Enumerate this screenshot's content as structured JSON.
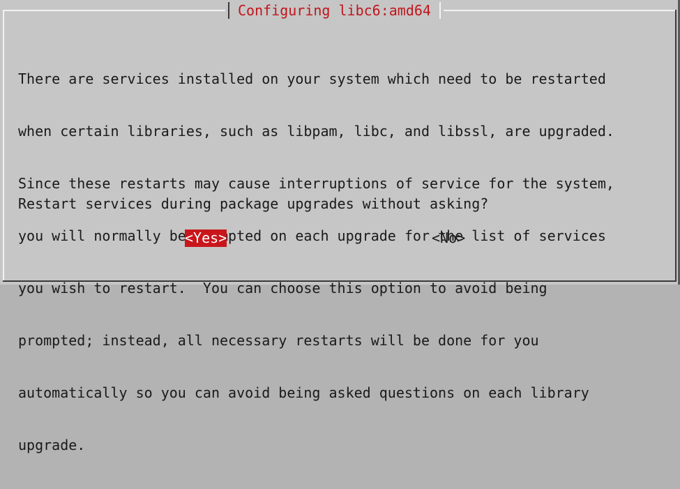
{
  "dialog": {
    "title": "Configuring libc6:amd64",
    "body_lines": [
      "There are services installed on your system which need to be restarted",
      "when certain libraries, such as libpam, libc, and libssl, are upgraded.",
      "Since these restarts may cause interruptions of service for the system,",
      "you will normally be prompted on each upgrade for the list of services",
      "you wish to restart.  You can choose this option to avoid being",
      "prompted; instead, all necessary restarts will be done for you",
      "automatically so you can avoid being asked questions on each library",
      "upgrade."
    ],
    "question": "Restart services during package upgrades without asking?",
    "buttons": {
      "yes_label": "<Yes>",
      "no_label": "<No>",
      "selected": "yes"
    }
  },
  "colors": {
    "background": "#c6c6c6",
    "title": "#c0161c",
    "selected_button": "#c9161b",
    "text": "#1a1a1a"
  }
}
